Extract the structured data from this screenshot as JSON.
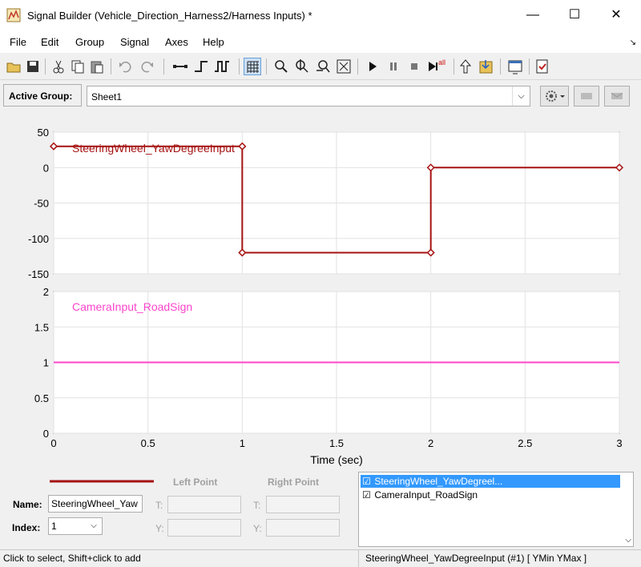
{
  "window": {
    "title": "Signal Builder (Vehicle_Direction_Harness2/Harness Inputs) *",
    "minimize": "—",
    "maximize": "☐",
    "close": "✕"
  },
  "menu": {
    "items": [
      "File",
      "Edit",
      "Group",
      "Signal",
      "Axes",
      "Help"
    ]
  },
  "toolbar": {
    "icons": [
      "open-icon",
      "save-icon",
      "cut-icon",
      "copy-icon",
      "paste-icon",
      "undo-icon",
      "redo-icon",
      "line-icon",
      "step-icon",
      "pulse-icon",
      "grid-icon",
      "zoom-x-icon",
      "zoom-y-icon",
      "zoom-xy-icon",
      "zoom-fit-icon",
      "play-icon",
      "pause-icon",
      "stop-icon",
      "run-all-icon",
      "up-arrow-icon",
      "import-icon",
      "window-icon",
      "verify-icon"
    ],
    "run_all_label": "all"
  },
  "group": {
    "label": "Active Group:",
    "value": "Sheet1"
  },
  "plots": {
    "top": {
      "signal_name": "SteeringWheel_YawDegreeInput",
      "color": "#a51212",
      "y_ticks": [
        "50",
        "0",
        "-50",
        "-100",
        "-150"
      ],
      "ylim": [
        -150,
        50
      ]
    },
    "bottom": {
      "signal_name": "CameraInput_RoadSign",
      "color": "#ff44cc",
      "y_ticks": [
        "2",
        "1.5",
        "1",
        "0.5",
        "0"
      ],
      "ylim": [
        0,
        2
      ]
    },
    "x_ticks": [
      "0",
      "0.5",
      "1",
      "1.5",
      "2",
      "2.5",
      "3"
    ],
    "xlabel": "Time (sec)"
  },
  "chart_data": [
    {
      "type": "line",
      "series": [
        {
          "name": "SteeringWheel_YawDegreeInput",
          "x": [
            0,
            1,
            1,
            2,
            2,
            3
          ],
          "y": [
            30,
            30,
            -120,
            -120,
            0,
            0
          ]
        }
      ],
      "xlim": [
        0,
        3
      ],
      "ylim": [
        -150,
        50
      ],
      "grid": true
    },
    {
      "type": "line",
      "series": [
        {
          "name": "CameraInput_RoadSign",
          "x": [
            0,
            3
          ],
          "y": [
            1,
            1
          ]
        }
      ],
      "xlim": [
        0,
        3
      ],
      "ylim": [
        0,
        2
      ],
      "xlabel": "Time (sec)",
      "grid": true
    }
  ],
  "bottom": {
    "left_point": "Left Point",
    "right_point": "Right Point",
    "name_label": "Name:",
    "name_value": "SteeringWheel_Yaw",
    "index_label": "Index:",
    "index_value": "1",
    "t_label": "T:",
    "y_label": "Y:",
    "line_color": "#a51212"
  },
  "signals": [
    {
      "label": "SteeringWheel_YawDegreel...",
      "checked": "☑",
      "selected": true
    },
    {
      "label": "CameraInput_RoadSign",
      "checked": "☑",
      "selected": false
    }
  ],
  "status": {
    "left": "Click to select, Shift+click to add",
    "right": "SteeringWheel_YawDegreeInput (#1)  [ YMin YMax ]"
  }
}
